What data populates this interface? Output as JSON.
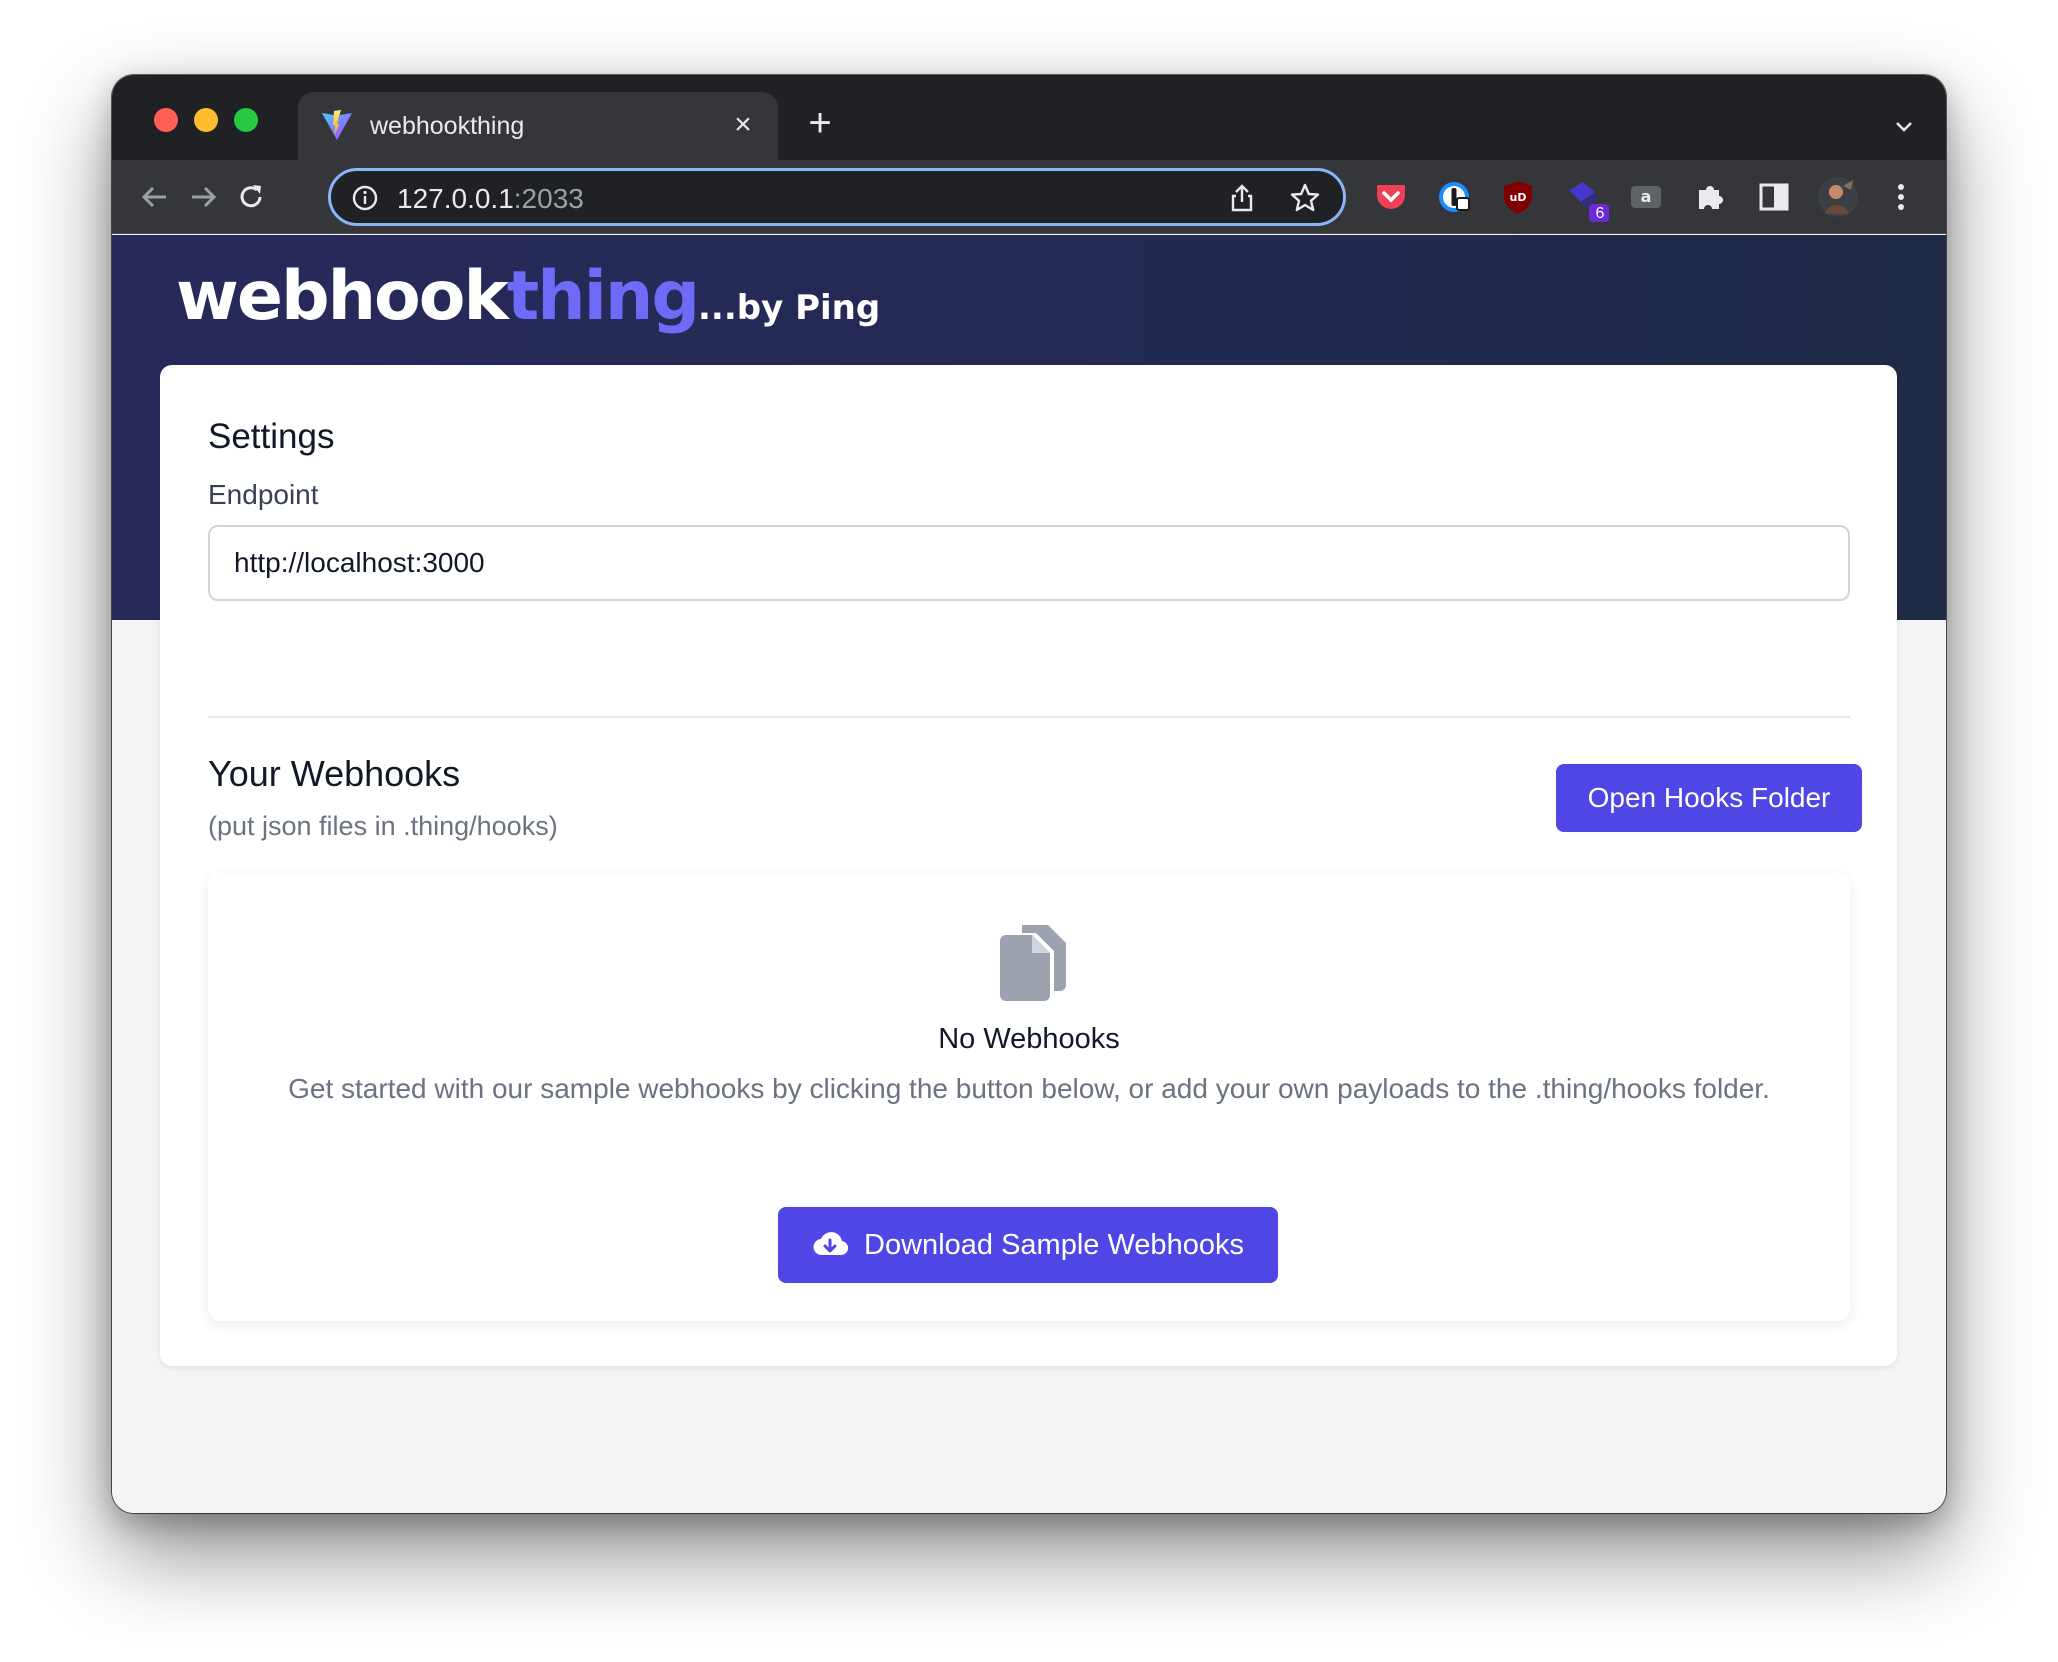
{
  "browser": {
    "tab_title": "webhookthing",
    "url_host": "127.0.0.1",
    "url_port": ":2033",
    "extension_badge": "6"
  },
  "brand": {
    "part1": "webhook",
    "part2": "thing",
    "part3": "...by Ping"
  },
  "settings": {
    "title": "Settings",
    "endpoint_label": "Endpoint",
    "endpoint_value": "http://localhost:3000"
  },
  "webhooks": {
    "title": "Your Webhooks",
    "subtitle": "(put json files in .thing/hooks)",
    "open_folder_label": "Open Hooks Folder",
    "empty_title": "No Webhooks",
    "empty_description": "Get started with our sample webhooks by clicking the button below, or add your own payloads to the .thing/hooks folder.",
    "download_label": "Download Sample Webhooks"
  },
  "colors": {
    "accent": "#4f46e5",
    "brand_highlight": "#6f6af8",
    "hero_bg": "#27295b",
    "page_bg": "#f3f4f6"
  }
}
